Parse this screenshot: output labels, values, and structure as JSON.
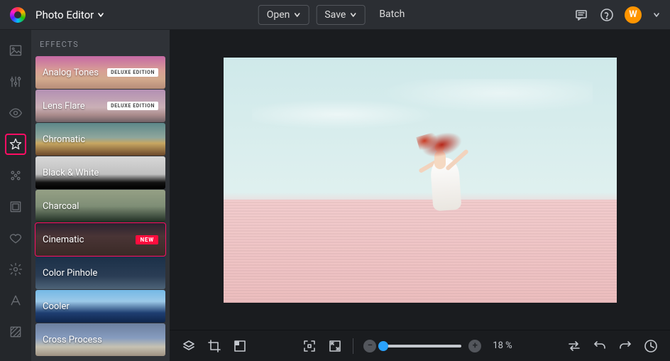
{
  "header": {
    "product_name": "Photo Editor",
    "open_label": "Open",
    "save_label": "Save",
    "batch_label": "Batch",
    "avatar_initial": "W"
  },
  "panel": {
    "title": "EFFECTS",
    "effects": [
      {
        "label": "Analog Tones",
        "badge": "DELUXE EDITION"
      },
      {
        "label": "Lens Flare",
        "badge": "DELUXE EDITION"
      },
      {
        "label": "Chromatic"
      },
      {
        "label": "Black & White"
      },
      {
        "label": "Charcoal"
      },
      {
        "label": "Cinematic",
        "new": "NEW"
      },
      {
        "label": "Color Pinhole"
      },
      {
        "label": "Cooler"
      },
      {
        "label": "Cross Process"
      }
    ]
  },
  "bottombar": {
    "zoom_percent_label": "18 %"
  },
  "colors": {
    "highlight": "#ff0d63",
    "avatar_bg": "#ff9500",
    "zoom_handle": "#2aa3ff"
  },
  "effect_backgrounds": {
    "0": "linear-gradient(180deg,#c66aa5 0%,#d89f95 45%,#d2aa8e 70%,#b78c78 100%)",
    "1": "linear-gradient(180deg,#b38fb3 0%,#cab0b6 55%,#aa8b8b 78%,#6f6166 100%)",
    "2": "linear-gradient(180deg,#5d888a 0%,#8fa69c 45%,#c8a762 62%,#6a472a 100%)",
    "3": "linear-gradient(180deg,#d8d8d8 0%,#bfbfbf 55%,#111 80%,#000 100%)",
    "4": "linear-gradient(180deg,#95a085 0%,#7f8e76 50%,#1e2d22 100%)",
    "5": "linear-gradient(180deg,#2a2230 0%,#4a3536 40%,#3a2a26 100%)",
    "6": "linear-gradient(180deg,#1b3048 0%,#2a3d55 60%,#4e6478 100%)",
    "7": "linear-gradient(180deg,#74b8e6 0%,#9cc9e8 35%,#1f3f72 70%,#0e244a 100%)",
    "8": "linear-gradient(180deg,#6c7f9e 0%,#869cbf 45%,#c6c2b2 72%,#9d9081 100%)"
  }
}
